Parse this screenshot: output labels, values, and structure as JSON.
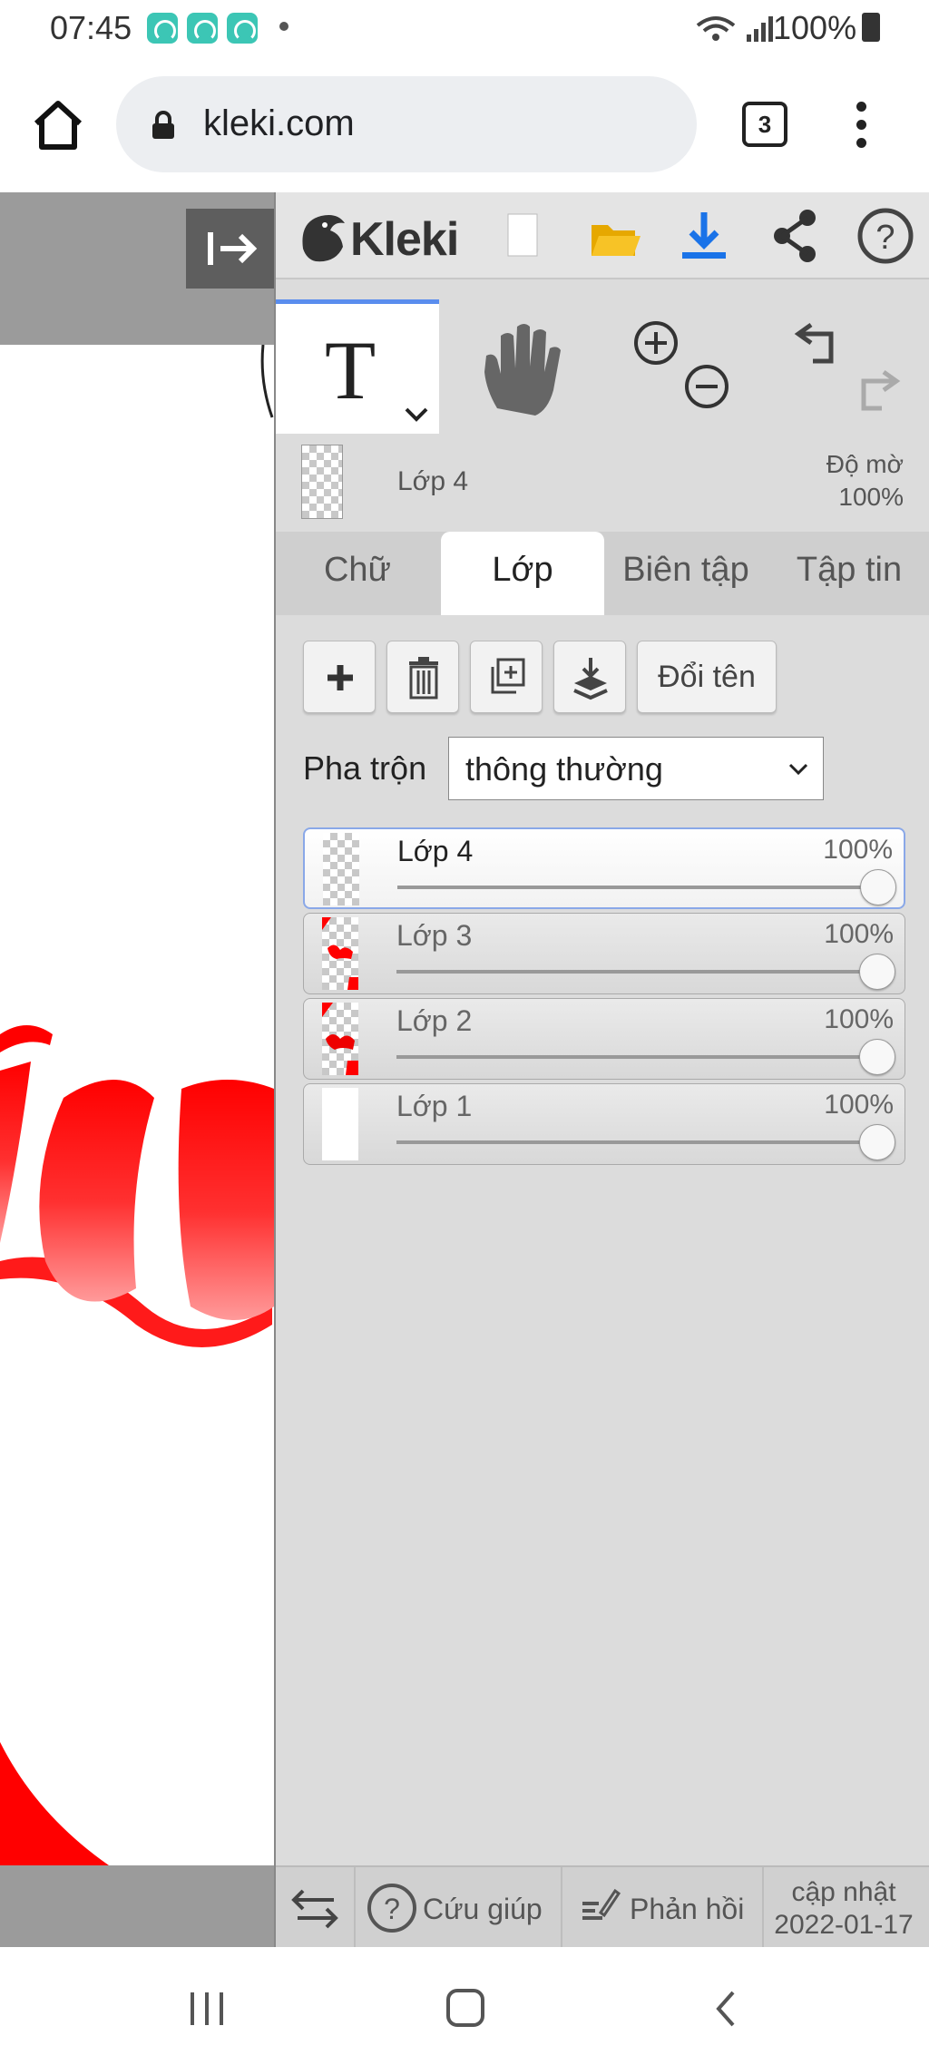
{
  "status_bar": {
    "time": "07:45",
    "battery": "100%"
  },
  "browser": {
    "url": "kleki.com",
    "tab_count": "3"
  },
  "app": {
    "logo_text": "Kleki",
    "current_layer": {
      "name": "Lớp 4",
      "opacity_label": "Độ mờ",
      "opacity_value": "100%"
    },
    "tabs": [
      {
        "label": "Chữ",
        "active": false
      },
      {
        "label": "Lớp",
        "active": true
      },
      {
        "label": "Biên tập",
        "active": false
      },
      {
        "label": "Tập tin",
        "active": false
      }
    ],
    "layer_buttons": {
      "rename": "Đổi tên"
    },
    "blend": {
      "label": "Pha trộn",
      "value": "thông thường"
    },
    "layers": [
      {
        "name": "Lớp 4",
        "opacity": "100%",
        "opacity_fraction": 1.0,
        "selected": true
      },
      {
        "name": "Lớp 3",
        "opacity": "100%",
        "opacity_fraction": 1.0,
        "selected": false
      },
      {
        "name": "Lớp 2",
        "opacity": "100%",
        "opacity_fraction": 1.0,
        "selected": false
      },
      {
        "name": "Lớp 1",
        "opacity": "100%",
        "opacity_fraction": 1.0,
        "selected": false
      }
    ],
    "bottom": {
      "help": "Cứu giúp",
      "feedback": "Phản hồi",
      "update_label": "cập nhật",
      "update_date": "2022-01-17"
    }
  },
  "colors": {
    "accent": "#5a8dee",
    "download": "#1a73e8",
    "folder": "#f2b90d",
    "drawing_red": "#ff0000"
  }
}
